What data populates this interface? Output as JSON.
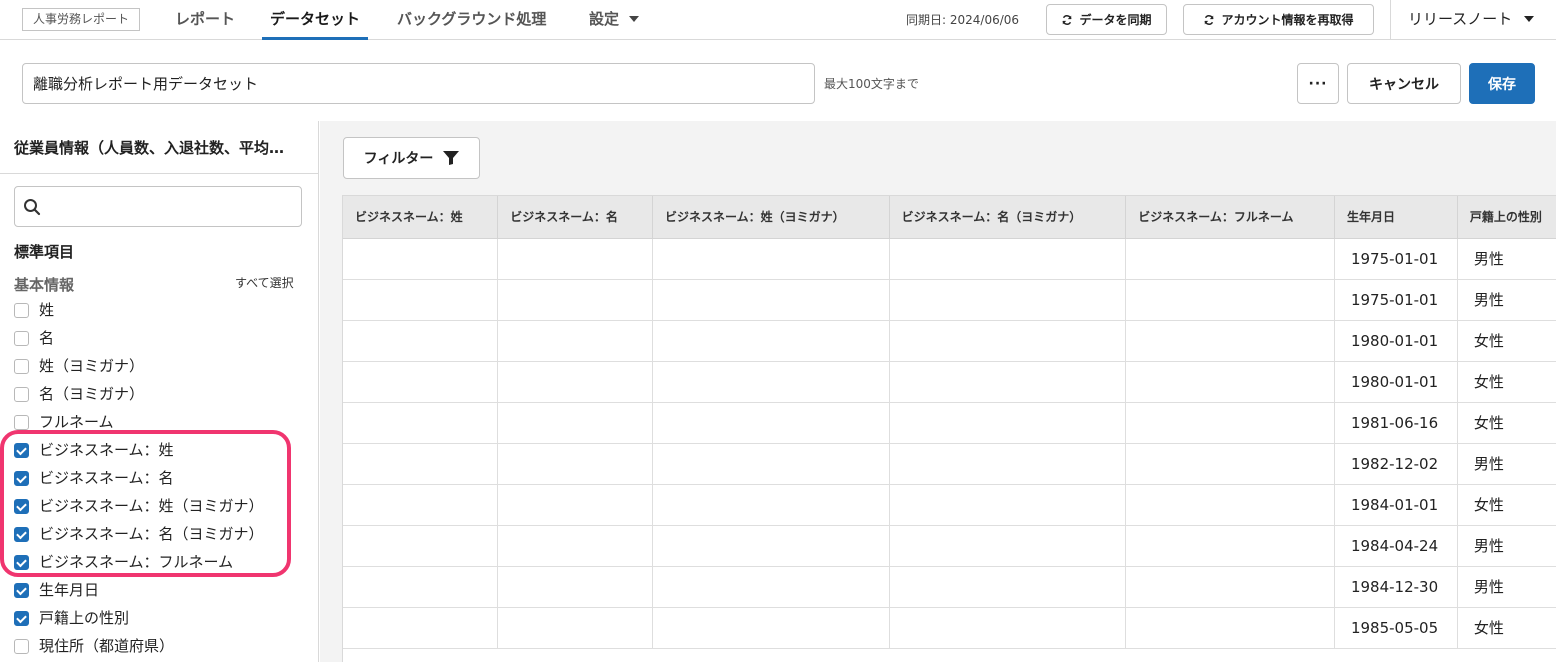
{
  "nav": {
    "brand": "人事労務レポート",
    "tabs": [
      {
        "label": "レポート"
      },
      {
        "label": "データセット",
        "active": true
      },
      {
        "label": "バックグラウンド処理"
      },
      {
        "label": "設定"
      }
    ],
    "sync_date": "同期日: 2024/06/06",
    "sync_button": "データを同期",
    "refetch_button": "アカウント情報を再取得",
    "release_notes": "リリースノート"
  },
  "header": {
    "dataset_name": "離職分析レポート用データセット",
    "char_limit_hint": "最大100文字まで",
    "more_button": "···",
    "cancel_button": "キャンセル",
    "save_button": "保存"
  },
  "sidebar": {
    "title": "従業員情報（人員数、入退社数、平均…",
    "search_value": "",
    "section": "標準項目",
    "group": "基本情報",
    "select_all": "すべて選択",
    "fields": [
      {
        "label": "姓",
        "checked": false
      },
      {
        "label": "名",
        "checked": false
      },
      {
        "label": "姓（ヨミガナ）",
        "checked": false
      },
      {
        "label": "名（ヨミガナ）",
        "checked": false
      },
      {
        "label": "フルネーム",
        "checked": false
      },
      {
        "label": "ビジネスネーム：姓",
        "checked": true
      },
      {
        "label": "ビジネスネーム：名",
        "checked": true
      },
      {
        "label": "ビジネスネーム：姓（ヨミガナ）",
        "checked": true
      },
      {
        "label": "ビジネスネーム：名（ヨミガナ）",
        "checked": true
      },
      {
        "label": "ビジネスネーム：フルネーム",
        "checked": true
      },
      {
        "label": "生年月日",
        "checked": true
      },
      {
        "label": "戸籍上の性別",
        "checked": true
      },
      {
        "label": "現住所（都道府県）",
        "checked": false
      }
    ]
  },
  "main": {
    "filter_button": "フィルター",
    "table": {
      "columns": [
        "ビジネスネーム：姓",
        "ビジネスネーム：名",
        "ビジネスネーム：姓（ヨミガナ）",
        "ビジネスネーム：名（ヨミガナ）",
        "ビジネスネーム：フルネーム",
        "生年月日",
        "戸籍上の性別"
      ],
      "rows": [
        [
          "",
          "",
          "",
          "",
          "",
          "1975-01-01",
          "男性"
        ],
        [
          "",
          "",
          "",
          "",
          "",
          "1975-01-01",
          "男性"
        ],
        [
          "",
          "",
          "",
          "",
          "",
          "1980-01-01",
          "女性"
        ],
        [
          "",
          "",
          "",
          "",
          "",
          "1980-01-01",
          "女性"
        ],
        [
          "",
          "",
          "",
          "",
          "",
          "1981-06-16",
          "女性"
        ],
        [
          "",
          "",
          "",
          "",
          "",
          "1982-12-02",
          "男性"
        ],
        [
          "",
          "",
          "",
          "",
          "",
          "1984-01-01",
          "女性"
        ],
        [
          "",
          "",
          "",
          "",
          "",
          "1984-04-24",
          "男性"
        ],
        [
          "",
          "",
          "",
          "",
          "",
          "1984-12-30",
          "男性"
        ],
        [
          "",
          "",
          "",
          "",
          "",
          "1985-05-05",
          "女性"
        ]
      ]
    }
  },
  "colors": {
    "accent": "#1e6fb8",
    "highlight": "#f0356f"
  }
}
